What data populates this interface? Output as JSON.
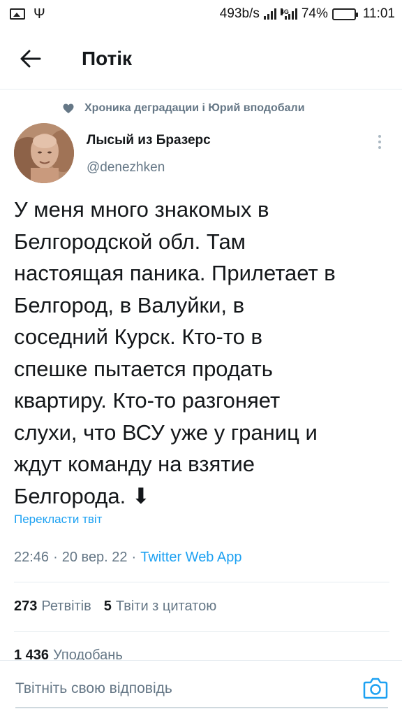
{
  "status_bar": {
    "speed": "493b/s",
    "network": "4G",
    "battery": "74%",
    "battery_level": 0.74,
    "time": "11:01"
  },
  "header": {
    "title": "Потік",
    "back_icon": "arrow-left-icon"
  },
  "tweet": {
    "social_context": "Хроника деградации і Юрий вподобали",
    "social_icon": "heart-icon",
    "author_name": "Лысый из Бразерс",
    "author_handle": "@denezhken",
    "text": "У меня много знакомых в\nБелгородской обл. Там\nнастоящая паника. Прилетает в\nБелгород, в Валуйки, в\nсоседний Курск. Кто-то в\nспешке пытается продать\nквартиру. Кто-то разгоняет\nслухи, что ВСУ уже у границ и\nждут команду на взятие\nБелгорода. ⬇",
    "translate": "Перекласти твіт",
    "time": "22:46",
    "date": "20 вер. 22",
    "separator": "·",
    "source": "Twitter Web App",
    "retweets_count": "273",
    "retweets_label": "Ретвітів",
    "quotes_count": "5",
    "quotes_label": "Твіти з цитатою",
    "likes_count": "1 436",
    "likes_label": "Уподобань"
  },
  "reply": {
    "placeholder": "Твітніть свою відповідь",
    "camera_icon": "camera-icon"
  },
  "colors": {
    "accent": "#1da1f2",
    "secondary_text": "#657786",
    "primary_text": "#14171a",
    "divider": "#e6ecf0",
    "battery": "#35c44a"
  }
}
